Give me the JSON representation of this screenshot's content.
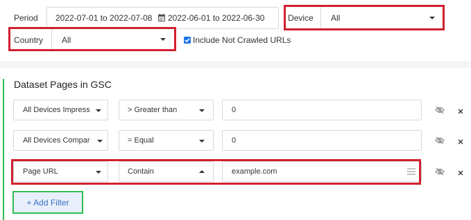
{
  "filters_top": {
    "period_label": "Period",
    "date_range_1": "2022-07-01 to 2022-07-08",
    "date_range_2": "2022-06-01 to 2022-06-30",
    "device_label": "Device",
    "device_value": "All",
    "country_label": "Country",
    "country_value": "All",
    "include_not_crawled_label": "Include Not Crawled URLs",
    "include_not_crawled_checked": true
  },
  "dataset": {
    "title": "Dataset Pages in GSC",
    "rows": [
      {
        "field": "All Devices Impress",
        "operator": "> Greater than",
        "value": "0"
      },
      {
        "field": "All Devices Compar",
        "operator": "= Equal",
        "value": "0"
      },
      {
        "field": "Page URL",
        "operator": "Contain",
        "value": "example.com"
      }
    ],
    "add_filter_label": "+ Add Filter"
  },
  "colors": {
    "highlight_red": "#d0202e",
    "highlight_green": "#2ebd4f",
    "accent_blue": "#3a6fc4"
  }
}
